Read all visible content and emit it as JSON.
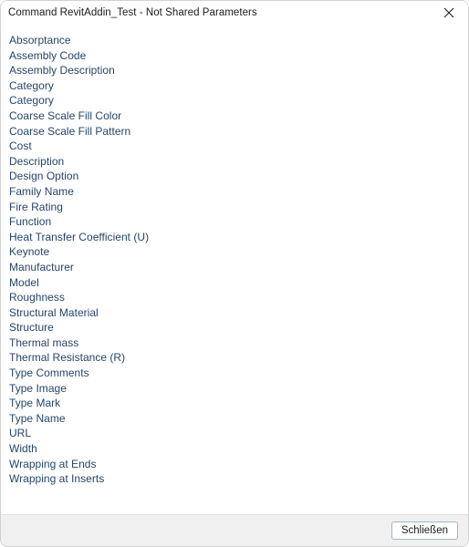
{
  "dialog": {
    "title": "Command RevitAddin_Test - Not Shared Parameters",
    "close_icon": "close-icon",
    "accent_text_color": "#26456b",
    "title_color": "#1b1b1b",
    "footer_background": "#f0f0f0",
    "button_border_color": "#9fb6cd"
  },
  "parameters": [
    {
      "label": "Absorptance"
    },
    {
      "label": "Assembly Code"
    },
    {
      "label": "Assembly Description"
    },
    {
      "label": "Category"
    },
    {
      "label": "Category"
    },
    {
      "label": "Coarse Scale Fill Color"
    },
    {
      "label": "Coarse Scale Fill Pattern"
    },
    {
      "label": "Cost"
    },
    {
      "label": "Description"
    },
    {
      "label": "Design Option"
    },
    {
      "label": "Family Name"
    },
    {
      "label": "Fire Rating"
    },
    {
      "label": "Function"
    },
    {
      "label": "Heat Transfer Coefficient (U)"
    },
    {
      "label": "Keynote"
    },
    {
      "label": "Manufacturer"
    },
    {
      "label": "Model"
    },
    {
      "label": "Roughness"
    },
    {
      "label": "Structural Material"
    },
    {
      "label": "Structure"
    },
    {
      "label": "Thermal mass"
    },
    {
      "label": "Thermal Resistance (R)"
    },
    {
      "label": "Type Comments"
    },
    {
      "label": "Type Image"
    },
    {
      "label": "Type Mark"
    },
    {
      "label": "Type Name"
    },
    {
      "label": "URL"
    },
    {
      "label": "Width"
    },
    {
      "label": "Wrapping at Ends"
    },
    {
      "label": "Wrapping at Inserts"
    }
  ],
  "footer": {
    "close_label": "Schließen"
  }
}
